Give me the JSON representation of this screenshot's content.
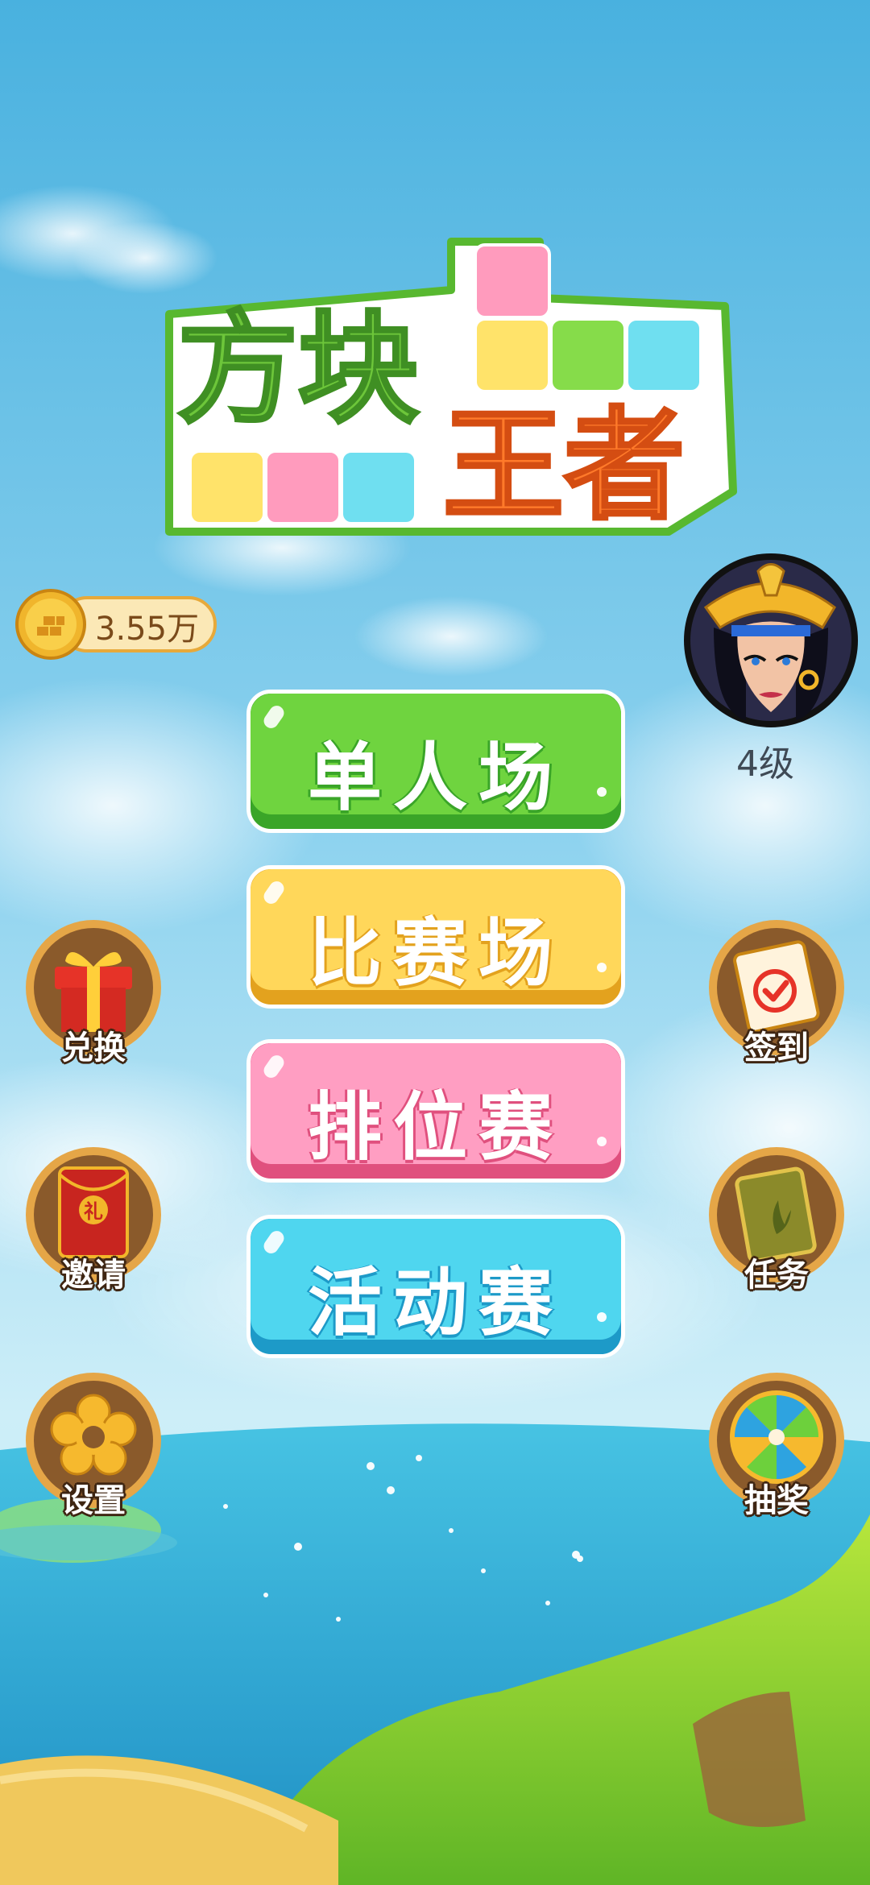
{
  "game": {
    "title_line1": "方块",
    "title_line2": "王者"
  },
  "player": {
    "coins": "3.55万",
    "level": "4级"
  },
  "modes": [
    {
      "label": "单人场",
      "color": "#6fd43f",
      "shade": "#3aa528"
    },
    {
      "label": "比赛场",
      "color": "#ffd75a",
      "shade": "#e3a21e"
    },
    {
      "label": "排位赛",
      "color": "#ff9ec2",
      "shade": "#e0507e"
    },
    {
      "label": "活动赛",
      "color": "#4fd6ef",
      "shade": "#1d9ac8"
    }
  ],
  "left_actions": [
    {
      "label": "兑换",
      "icon": "gift-icon"
    },
    {
      "label": "邀请",
      "icon": "red-envelope-icon"
    },
    {
      "label": "设置",
      "icon": "flower-gear-icon"
    }
  ],
  "right_actions": [
    {
      "label": "签到",
      "icon": "calendar-check-icon"
    },
    {
      "label": "任务",
      "icon": "task-book-icon"
    },
    {
      "label": "抽奖",
      "icon": "prize-wheel-icon"
    }
  ],
  "colors": {
    "sky_top": "#4fb6e0",
    "sky_bottom": "#c6ecf6",
    "sea": "#2fb2d7",
    "grass": "#88cf2d",
    "button_ring": "#d08a2a"
  }
}
